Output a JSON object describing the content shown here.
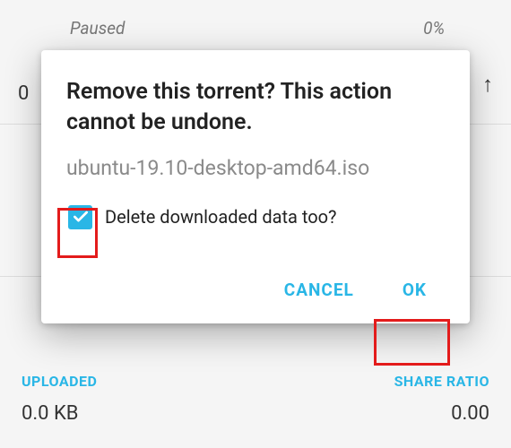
{
  "bg": {
    "status": "Paused",
    "percent": "0%",
    "zero": "0",
    "uploaded_label": "UPLOADED",
    "uploaded_value": "0.0 KB",
    "share_ratio_label": "SHARE RATIO",
    "share_ratio_value": "0.00"
  },
  "dialog": {
    "title": "Remove this torrent? This action cannot be undone.",
    "filename": "ubuntu-19.10-desktop-amd64.iso",
    "checkbox_label": "Delete downloaded data too?",
    "cancel": "CANCEL",
    "ok": "OK"
  }
}
